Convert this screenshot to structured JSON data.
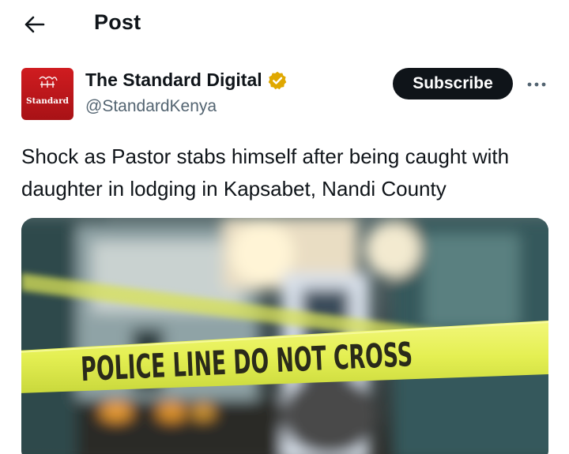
{
  "header": {
    "title": "Post",
    "back_icon": "arrow-left-icon"
  },
  "author": {
    "display_name": "The Standard Digital",
    "handle": "@StandardKenya",
    "avatar_text": "Standard",
    "verified_icon": "verified-badge-icon",
    "verified_color": "#e0a800"
  },
  "actions": {
    "subscribe_label": "Subscribe",
    "more_icon": "more-horizontal-icon"
  },
  "post": {
    "text": "Shock as Pastor stabs himself after being caught with daughter in lodging in Kapsabet, Nandi County"
  },
  "media": {
    "tape_text": "POLICE LINE DO NOT CROSS",
    "tape_color": "#e8f25a"
  }
}
